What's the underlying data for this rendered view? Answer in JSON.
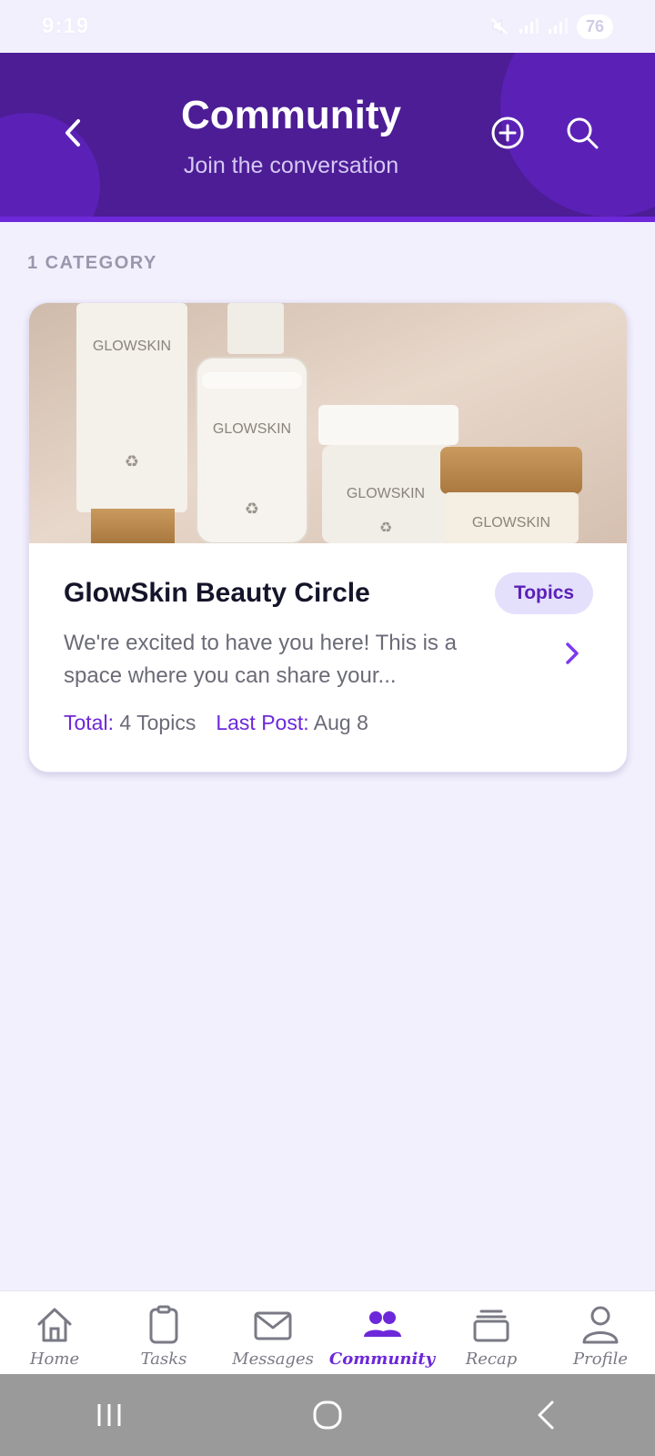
{
  "status_bar": {
    "time": "9:19",
    "battery": "76",
    "signal_glyph": "▯"
  },
  "header": {
    "title": "Community",
    "subtitle": "Join the conversation"
  },
  "section": {
    "label": "1 CATEGORY"
  },
  "category_card": {
    "title": "GlowSkin Beauty Circle",
    "badge": "Topics",
    "description": "We're excited to have you here! This is a space where you can share your...",
    "total_label": "Total:",
    "total_value": "4 Topics",
    "last_post_label": "Last Post:",
    "last_post_value": "Aug 8",
    "image_brand": "GLOWSKIN"
  },
  "bottom_nav": {
    "items": [
      {
        "label": "Home",
        "icon": "home-icon"
      },
      {
        "label": "Tasks",
        "icon": "clipboard-icon"
      },
      {
        "label": "Messages",
        "icon": "envelope-icon"
      },
      {
        "label": "Community",
        "icon": "people-icon",
        "active": true
      },
      {
        "label": "Recap",
        "icon": "stack-icon"
      },
      {
        "label": "Profile",
        "icon": "person-icon"
      }
    ]
  },
  "colors": {
    "primary": "#4c1d95",
    "accent": "#6d28d9",
    "background": "#f2f0fd"
  }
}
